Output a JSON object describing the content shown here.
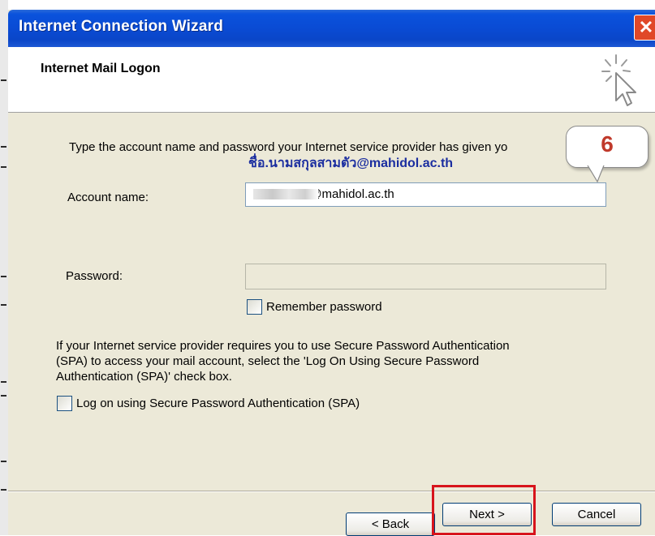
{
  "window": {
    "title": "Internet Connection Wizard",
    "close_glyph": "✕"
  },
  "header": {
    "title": "Internet Mail Logon",
    "icon": "wizard-cursor-icon"
  },
  "intro_text": "Type the account name and password your Internet service provider has given yo",
  "annotation": {
    "hint_text": "ชื่อ.นามสกุลสามตัว@mahidol.ac.th",
    "step_number": "6",
    "hint_color": "#1b2ea0",
    "step_color": "#c0392b"
  },
  "account": {
    "label": "Account name:",
    "value": "i@mahidol.ac.th"
  },
  "password": {
    "label": "Password:",
    "value": ""
  },
  "remember_password": {
    "label": "Remember password",
    "checked": false
  },
  "spa_text": {
    "line1": "If your Internet service provider requires you to use Secure Password Authentication",
    "line2": "(SPA) to access your mail account, select the 'Log On Using Secure Password",
    "line3": "Authentication (SPA)' check box."
  },
  "spa_checkbox": {
    "label": "Log on using Secure Password Authentication (SPA)",
    "checked": false
  },
  "buttons": {
    "back": "< Back",
    "next": "Next >",
    "cancel": "Cancel"
  },
  "colors": {
    "titlebar": "#0a4bd4",
    "dialog_bg": "#ece9d8",
    "highlight": "#d7141c"
  }
}
